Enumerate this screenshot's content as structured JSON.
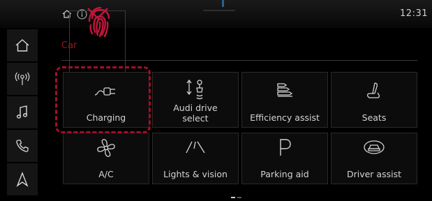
{
  "status": {
    "time": "12:31"
  },
  "sidebar": {
    "items": [
      {
        "icon": "home-icon"
      },
      {
        "icon": "radio-icon"
      },
      {
        "icon": "music-icon"
      },
      {
        "icon": "phone-icon"
      },
      {
        "icon": "navigation-icon"
      }
    ]
  },
  "main": {
    "section_label": "Car",
    "tiles": [
      {
        "label": "Charging",
        "icon": "charging-plug-icon"
      },
      {
        "label_line1": "Audi drive",
        "label_line2": "select",
        "icon": "drive-select-icon"
      },
      {
        "label": "Efficiency assist",
        "icon": "efficiency-icon"
      },
      {
        "label": "Seats",
        "icon": "seat-icon"
      },
      {
        "label": "A/C",
        "icon": "fan-icon"
      },
      {
        "label": "Lights & vision",
        "icon": "lights-icon"
      },
      {
        "label": "Parking aid",
        "icon": "parking-icon"
      },
      {
        "label": "Driver assist",
        "icon": "driver-assist-icon"
      }
    ]
  },
  "colors": {
    "accent_red": "#a50d2d",
    "section_label": "#8c1c22",
    "background": "#000000"
  }
}
